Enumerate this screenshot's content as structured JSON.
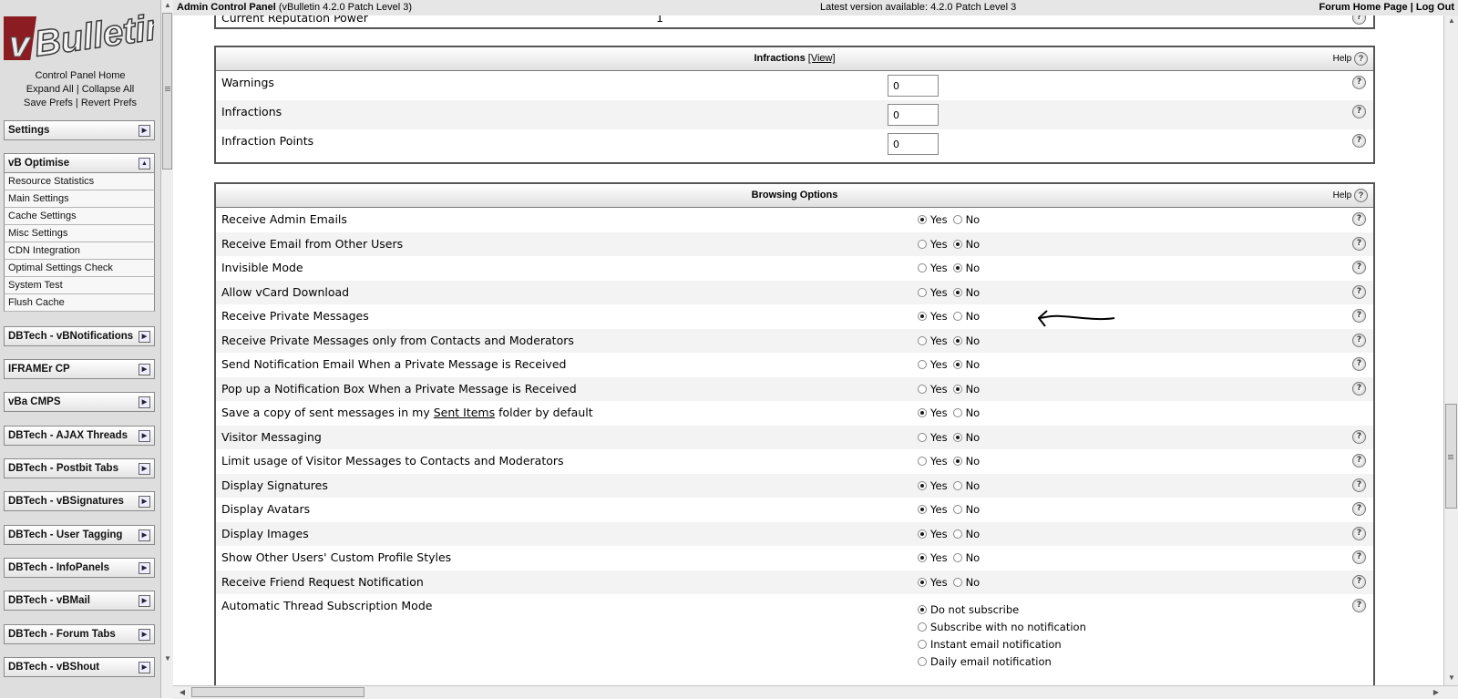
{
  "nav": {
    "logo_text": "vBulletin",
    "links": {
      "home": "Control Panel Home",
      "expand": "Expand All",
      "collapse": "Collapse All",
      "save": "Save Prefs",
      "revert": "Revert Prefs",
      "sep": "|"
    },
    "groups": [
      {
        "title": "Settings",
        "toggle": "▶",
        "items": []
      },
      {
        "title": "vB Optimise",
        "toggle": "▲",
        "items": [
          "Resource Statistics",
          "Main Settings",
          "Cache Settings",
          "Misc Settings",
          "CDN Integration",
          "Optimal Settings Check",
          "System Test",
          "Flush Cache"
        ]
      },
      {
        "title": "DBTech - vBNotifications",
        "toggle": "▶",
        "items": []
      },
      {
        "title": "IFRAMEr CP",
        "toggle": "▶",
        "items": []
      },
      {
        "title": "vBa CMPS",
        "toggle": "▶",
        "items": []
      },
      {
        "title": "DBTech - AJAX Threads",
        "toggle": "▶",
        "items": []
      },
      {
        "title": "DBTech - Postbit Tabs",
        "toggle": "▶",
        "items": []
      },
      {
        "title": "DBTech - vBSignatures",
        "toggle": "▶",
        "items": []
      },
      {
        "title": "DBTech - User Tagging",
        "toggle": "▶",
        "items": []
      },
      {
        "title": "DBTech - InfoPanels",
        "toggle": "▶",
        "items": []
      },
      {
        "title": "DBTech - vBMail",
        "toggle": "▶",
        "items": []
      },
      {
        "title": "DBTech - Forum Tabs",
        "toggle": "▶",
        "items": []
      },
      {
        "title": "DBTech - vBShout",
        "toggle": "▶",
        "items": []
      }
    ]
  },
  "topbar": {
    "title": "Admin Control Panel",
    "version": "(vBulletin 4.2.0 Patch Level 3)",
    "latest": "Latest version available: 4.2.0 Patch Level 3",
    "forum_home": "Forum Home Page",
    "sep": "|",
    "logout": "Log Out"
  },
  "partial_row": {
    "label": "Current Reputation Power",
    "value": "1"
  },
  "infractions": {
    "title": "Infractions",
    "view_link": "[View]",
    "help": "Help",
    "rows": [
      {
        "label": "Warnings",
        "value": "0"
      },
      {
        "label": "Infractions",
        "value": "0"
      },
      {
        "label": "Infraction Points",
        "value": "0"
      }
    ]
  },
  "browsing": {
    "title": "Browsing Options",
    "help": "Help",
    "yes": "Yes",
    "no": "No",
    "rows": [
      {
        "label": "Receive Admin Emails",
        "selected": "yes",
        "help": true
      },
      {
        "label": "Receive Email from Other Users",
        "selected": "no",
        "help": true
      },
      {
        "label": "Invisible Mode",
        "selected": "no",
        "help": true
      },
      {
        "label": "Allow vCard Download",
        "selected": "no",
        "help": true
      },
      {
        "label": "Receive Private Messages",
        "selected": "yes",
        "help": true
      },
      {
        "label": "Receive Private Messages only from Contacts and Moderators",
        "selected": "no",
        "help": true
      },
      {
        "label": "Send Notification Email When a Private Message is Received",
        "selected": "no",
        "help": true
      },
      {
        "label": "Pop up a Notification Box When a Private Message is Received",
        "selected": "no",
        "help": true
      },
      {
        "label_before": "Save a copy of sent messages in my ",
        "label_link": "Sent Items",
        "label_after": " folder by default",
        "selected": "yes",
        "help": false
      },
      {
        "label": "Visitor Messaging",
        "selected": "no",
        "help": true
      },
      {
        "label": "Limit usage of Visitor Messages to Contacts and Moderators",
        "selected": "no",
        "help": true
      },
      {
        "label": "Display Signatures",
        "selected": "yes",
        "help": true
      },
      {
        "label": "Display Avatars",
        "selected": "yes",
        "help": true
      },
      {
        "label": "Display Images",
        "selected": "yes",
        "help": true
      },
      {
        "label": "Show Other Users' Custom Profile Styles",
        "selected": "yes",
        "help": true
      },
      {
        "label": "Receive Friend Request Notification",
        "selected": "yes",
        "help": true
      }
    ],
    "subscription": {
      "label": "Automatic Thread Subscription Mode",
      "options": [
        "Do not subscribe",
        "Subscribe with no notification",
        "Instant email notification",
        "Daily email notification"
      ],
      "selected_index": 0
    }
  }
}
